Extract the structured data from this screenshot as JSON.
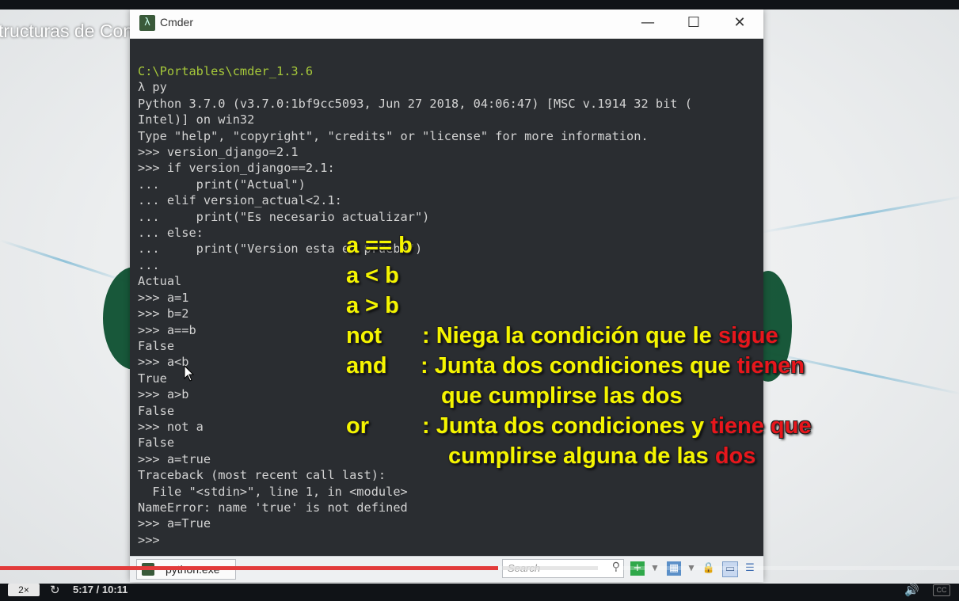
{
  "video": {
    "title": "tructuras de Control",
    "speed_label": "2×",
    "time": "5:17 / 10:11",
    "progress_fraction": 0.519
  },
  "window": {
    "title": "Cmder",
    "minimize": "—",
    "maximize": "☐",
    "close": "✕"
  },
  "console": {
    "path": "C:\\Portables\\cmder_1.3.6",
    "body": "λ py\nPython 3.7.0 (v3.7.0:1bf9cc5093, Jun 27 2018, 04:06:47) [MSC v.1914 32 bit (\nIntel)] on win32\nType \"help\", \"copyright\", \"credits\" or \"license\" for more information.\n>>> version_django=2.1\n>>> if version_django==2.1:\n...     print(\"Actual\")\n... elif version_actual<2.1:\n...     print(\"Es necesario actualizar\")\n... else:\n...     print(\"Version esta en prueba\")\n...\nActual\n>>> a=1\n>>> b=2\n>>> a==b\nFalse\n>>> a<b\nTrue\n>>> a>b\nFalse\n>>> not a\nFalse\n>>> a=true\nTraceback (most recent call last):\n  File \"<stdin>\", line 1, in <module>\nNameError: name 'true' is not defined\n>>> a=True\n>>>"
  },
  "statusbar": {
    "tab_label": "python.exe",
    "search_placeholder": "Search"
  },
  "overlay": {
    "line1": "a == b",
    "line2": "a < b",
    "line3": "a > b",
    "not_kw": "not",
    "not_desc": ": Niega la condición que le ",
    "not_red": "sigue",
    "and_kw": "and",
    "and_desc": ": Junta dos condiciones que ",
    "and_red": "tienen",
    "and_cont": "que cumplirse las dos",
    "or_kw": "or",
    "or_desc": ":  Junta dos condiciones y ",
    "or_red": "tiene que",
    "or_cont": "cumplirse alguna de las ",
    "or_cont_red": "dos"
  },
  "colors": {
    "overlay_yellow": "#f5f500",
    "overlay_red": "#e8161c",
    "path_green": "#a6c83a",
    "progress_red": "#e23b3b"
  }
}
